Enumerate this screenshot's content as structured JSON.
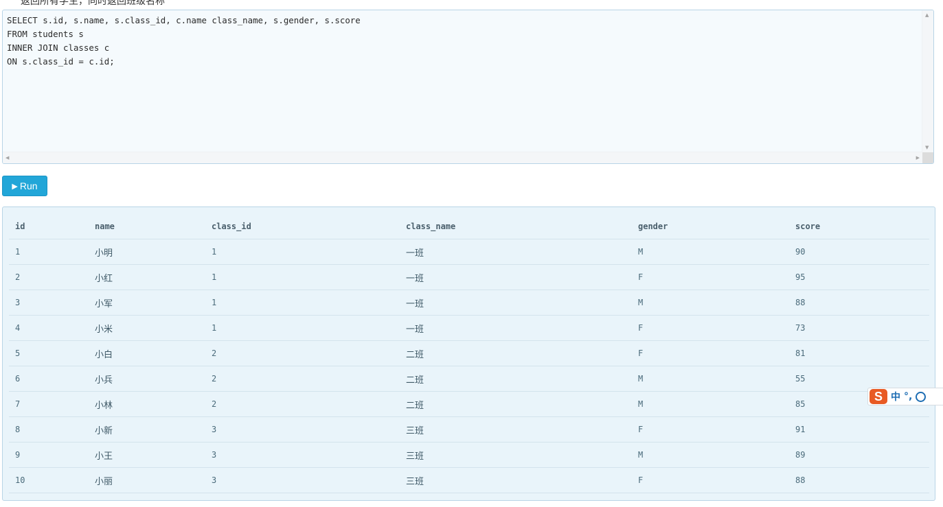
{
  "intro_text": "返回所有学生，同时返回班级名称",
  "editor": {
    "lines": [
      "SELECT s.id, s.name, s.class_id, c.name class_name, s.gender, s.score",
      "FROM students s",
      "INNER JOIN classes c",
      "ON s.class_id = c.id;"
    ]
  },
  "run_button": {
    "icon": "play-icon",
    "label": "Run"
  },
  "result": {
    "columns": [
      "id",
      "name",
      "class_id",
      "class_name",
      "gender",
      "score"
    ],
    "rows": [
      [
        "1",
        "小明",
        "1",
        "一班",
        "M",
        "90"
      ],
      [
        "2",
        "小红",
        "1",
        "一班",
        "F",
        "95"
      ],
      [
        "3",
        "小军",
        "1",
        "一班",
        "M",
        "88"
      ],
      [
        "4",
        "小米",
        "1",
        "一班",
        "F",
        "73"
      ],
      [
        "5",
        "小白",
        "2",
        "二班",
        "F",
        "81"
      ],
      [
        "6",
        "小兵",
        "2",
        "二班",
        "M",
        "55"
      ],
      [
        "7",
        "小林",
        "2",
        "二班",
        "M",
        "85"
      ],
      [
        "8",
        "小新",
        "3",
        "三班",
        "F",
        "91"
      ],
      [
        "9",
        "小王",
        "3",
        "三班",
        "M",
        "89"
      ],
      [
        "10",
        "小丽",
        "3",
        "三班",
        "F",
        "88"
      ]
    ]
  },
  "ime_toolbar": {
    "logo": "S",
    "mode": "中",
    "punct": "°,",
    "icons": [
      "sogou-logo-icon",
      "smiley-icon"
    ]
  },
  "colors": {
    "run_button": "#22a6d8",
    "panel_bg": "#e9f4fa",
    "panel_border": "#b8d4e6",
    "ime_logo": "#e85a24"
  }
}
